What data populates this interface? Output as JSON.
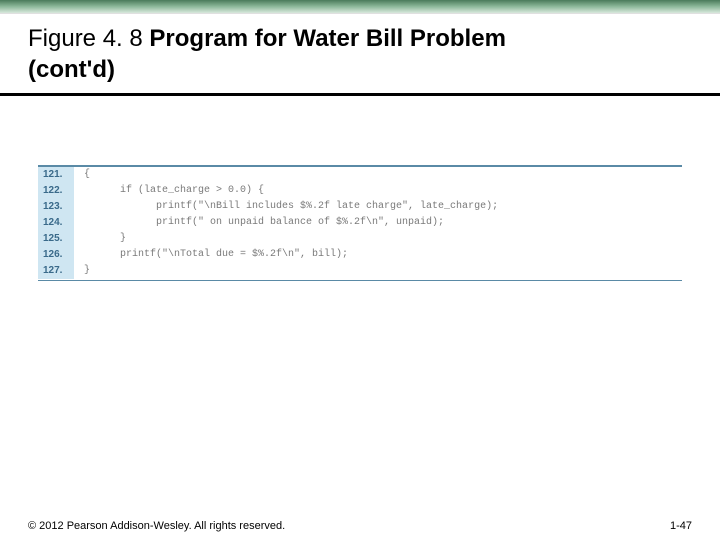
{
  "title": {
    "figure_label": "Figure 4. 8",
    "heading": "Program for Water Bill Problem",
    "cont": "(cont'd)"
  },
  "code": {
    "lines": [
      {
        "n": "121.",
        "t": "{"
      },
      {
        "n": "122.",
        "t": "      if (late_charge > 0.0) {"
      },
      {
        "n": "123.",
        "t": "            printf(\"\\nBill includes $%.2f late charge\", late_charge);"
      },
      {
        "n": "124.",
        "t": "            printf(\" on unpaid balance of $%.2f\\n\", unpaid);"
      },
      {
        "n": "125.",
        "t": "      }"
      },
      {
        "n": "126.",
        "t": "      printf(\"\\nTotal due = $%.2f\\n\", bill);"
      },
      {
        "n": "127.",
        "t": "}"
      }
    ]
  },
  "footer": {
    "copyright": "© 2012 Pearson Addison-Wesley. All rights reserved.",
    "page": "1-47"
  }
}
